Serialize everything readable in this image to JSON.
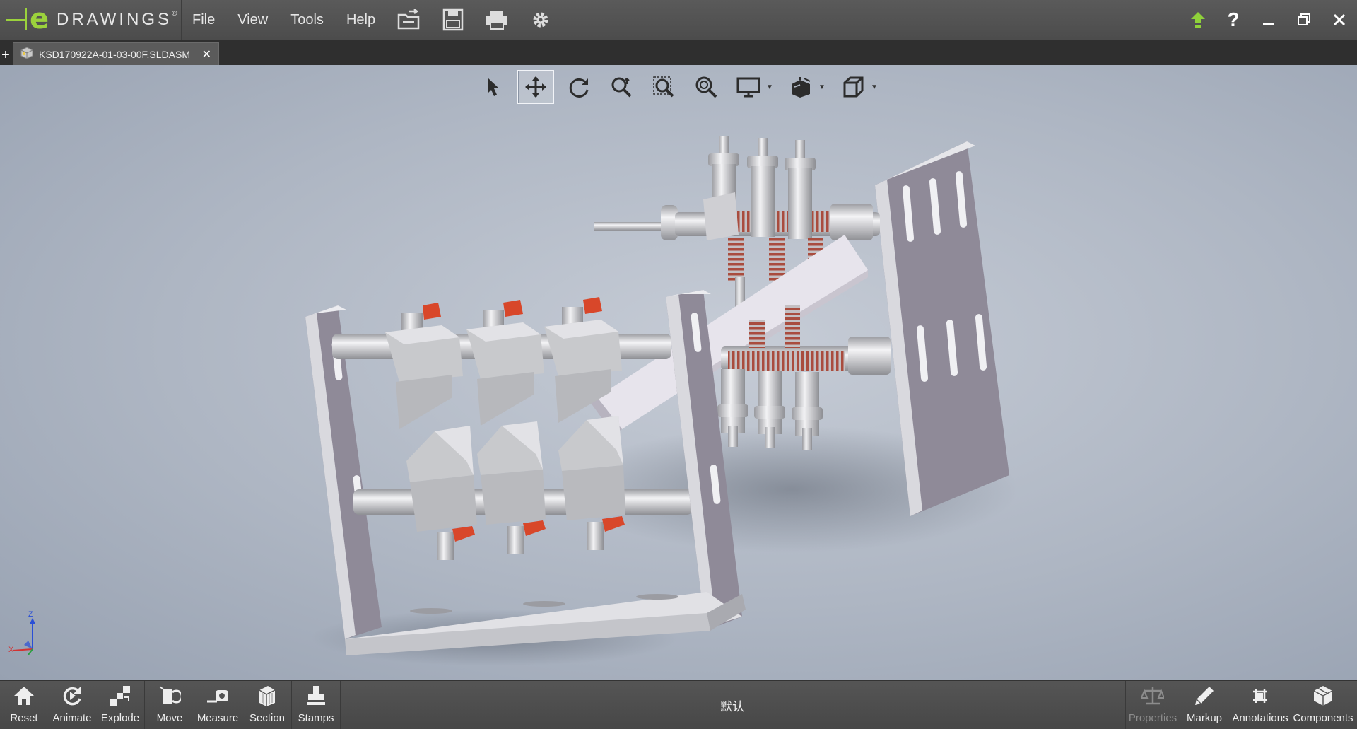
{
  "app": {
    "brand": "DRAWINGS",
    "brand_mark": "e",
    "registered": "®"
  },
  "menu": {
    "items": [
      "File",
      "View",
      "Tools",
      "Help"
    ]
  },
  "quick_toolbar": {
    "icons": [
      "open-file-icon",
      "save-icon",
      "print-icon",
      "settings-icon"
    ]
  },
  "window": {
    "icons": [
      "upload-icon",
      "help-icon",
      "minimize-icon",
      "restore-icon",
      "close-icon"
    ],
    "help_label": "?"
  },
  "tabs": {
    "add_label": "+",
    "active": {
      "label": "KSD170922A-01-03-00F.SLDASM",
      "close_label": "✕"
    }
  },
  "view_toolbar": {
    "tools": [
      {
        "icon": "select-pointer-icon",
        "active": false
      },
      {
        "icon": "pan-icon",
        "active": true
      },
      {
        "icon": "rotate-icon",
        "active": false
      },
      {
        "icon": "zoom-to-fit-icon",
        "active": false
      },
      {
        "icon": "zoom-to-area-icon",
        "active": false
      },
      {
        "icon": "zoom-icon",
        "active": false
      },
      {
        "icon": "display-style-icon",
        "has_dropdown": true
      },
      {
        "icon": "view-orientation-icon",
        "has_dropdown": true
      },
      {
        "icon": "standard-views-cube-icon",
        "has_dropdown": true
      }
    ]
  },
  "triad": {
    "z": "Z",
    "x": "X"
  },
  "bottom_toolbar": {
    "left": [
      {
        "label": "Reset",
        "icon": "home-icon"
      },
      {
        "label": "Animate",
        "icon": "animate-icon"
      },
      {
        "label": "Explode",
        "icon": "explode-icon"
      },
      {
        "label": "Move",
        "icon": "move-icon"
      },
      {
        "label": "Measure",
        "icon": "measure-icon"
      },
      {
        "label": "Section",
        "icon": "section-icon"
      },
      {
        "label": "Stamps",
        "icon": "stamps-icon"
      }
    ],
    "configuration": "默认",
    "right": [
      {
        "label": "Properties",
        "icon": "properties-scale-icon",
        "disabled": true
      },
      {
        "label": "Markup",
        "icon": "markup-pen-icon",
        "disabled": false
      },
      {
        "label": "Annotations",
        "icon": "annotations-icon",
        "disabled": false
      },
      {
        "label": "Components",
        "icon": "components-icon",
        "disabled": false
      }
    ]
  },
  "colors": {
    "brand_green": "#9bd23c",
    "part_gray": "#c8c9cc",
    "plate_purple": "#8f8a98",
    "handle_red": "#d8472a",
    "spring_red": "#b54a3a"
  }
}
